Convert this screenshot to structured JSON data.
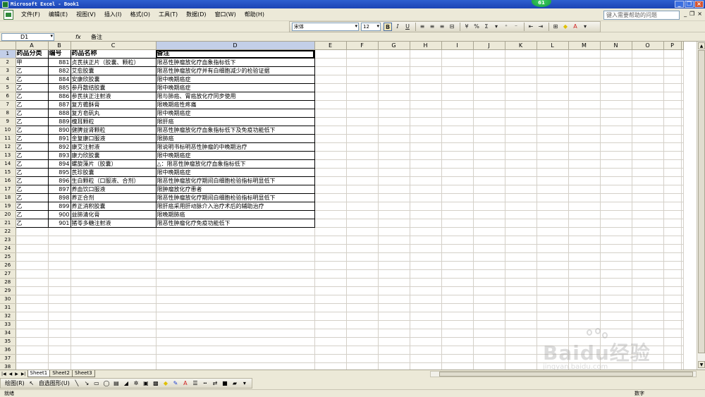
{
  "window": {
    "title": "Microsoft Excel - Book1",
    "badge": "61"
  },
  "menubar": {
    "items": [
      "文件(F)",
      "编辑(E)",
      "视图(V)",
      "插入(I)",
      "格式(O)",
      "工具(T)",
      "数据(D)",
      "窗口(W)",
      "帮助(H)"
    ],
    "help_placeholder": "键入需要帮助的问题"
  },
  "toolbar": {
    "font_name": "宋体",
    "font_size": "12",
    "bold": "B",
    "italic": "I",
    "underline": "U",
    "percent": "%",
    "sigma": "Σ"
  },
  "formula_bar": {
    "name_box": "D1",
    "fx": "fx",
    "content": "备注"
  },
  "columns": [
    "A",
    "B",
    "C",
    "D",
    "E",
    "F",
    "G",
    "H",
    "I",
    "J",
    "K",
    "L",
    "M",
    "N",
    "O",
    "P"
  ],
  "sheet": {
    "header": [
      "药品分类",
      "编号",
      "药品名称",
      "备注"
    ],
    "rows": [
      [
        "甲",
        "881",
        "贞芪扶正片（胶囊、颗粒）",
        "限恶性肿瘤放化疗血象指标低下"
      ],
      [
        "乙",
        "882",
        "艾愈胶囊",
        "限恶性肿瘤放化疗并有白细胞减少的检验证据"
      ],
      [
        "乙",
        "884",
        "安康欣胶囊",
        "限中晚期癌症"
      ],
      [
        "乙",
        "885",
        "参丹散结胶囊",
        "限中晚期癌症"
      ],
      [
        "乙",
        "886",
        "参芪扶正注射液",
        "限与肺癌、胃癌放化疗同步使用"
      ],
      [
        "乙",
        "887",
        "复方蟾酥膏",
        "限晚期癌性疼痛"
      ],
      [
        "乙",
        "888",
        "复方皂矾丸",
        "限中晚期癌症"
      ],
      [
        "乙",
        "889",
        "槐耳颗粒",
        "限肝癌"
      ],
      [
        "乙",
        "890",
        "健脾益肾颗粒",
        "限恶性肿瘤放化疗血象指标低下及免疫功能低下"
      ],
      [
        "乙",
        "891",
        "金复康口服液",
        "限肺癌"
      ],
      [
        "乙",
        "892",
        "康艾注射液",
        "限说明书标明恶性肿瘤的中晚期治疗"
      ],
      [
        "乙",
        "893",
        "康力欣胶囊",
        "限中晚期癌症"
      ],
      [
        "乙",
        "894",
        "螺旋藻片（胶囊）",
        "△：限恶性肿瘤放化疗血象指标低下"
      ],
      [
        "乙",
        "895",
        "芪珍胶囊",
        "限中晚期癌症"
      ],
      [
        "乙",
        "896",
        "生白颗粒（口服液、合剂）",
        "限恶性肿瘤放化疗期间白细胞检验指标明显低下"
      ],
      [
        "乙",
        "897",
        "养血饮口服液",
        "限肿瘤放化疗患者"
      ],
      [
        "乙",
        "898",
        "养正合剂",
        "限恶性肿瘤放化疗期间白细胞检验指标明显低下"
      ],
      [
        "乙",
        "899",
        "养正消积胶囊",
        "限肝癌采用肝动脉介入治疗术后的辅助治疗"
      ],
      [
        "乙",
        "900",
        "益肺清化膏",
        "限晚期肺癌"
      ],
      [
        "乙",
        "901",
        "猪苓多糖注射液",
        "限恶性肿瘤化疗免疫功能低下"
      ]
    ],
    "total_rows": 38
  },
  "tabs": [
    "Sheet1",
    "Sheet2",
    "Sheet3"
  ],
  "drawbar": {
    "draw_label": "绘图(R)",
    "autoshape_label": "自选图形(U)"
  },
  "status": {
    "left": "就绪",
    "right": "数字"
  },
  "watermark": {
    "brand": "Baidu经验",
    "url": "jingyan.baidu.com"
  }
}
